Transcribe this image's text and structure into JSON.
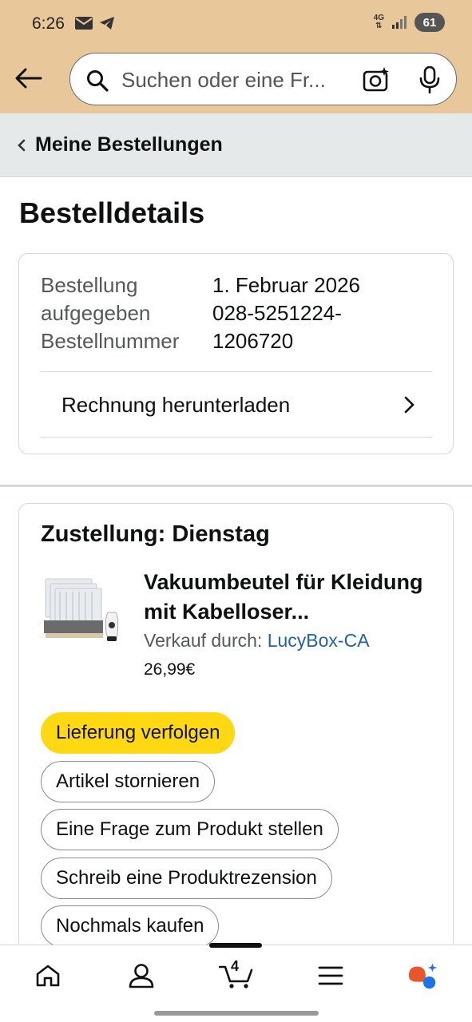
{
  "status_bar": {
    "time": "6:26",
    "network": "4G",
    "battery": "61"
  },
  "search": {
    "placeholder": "Suchen oder eine Fr..."
  },
  "breadcrumb": {
    "label": "Meine Bestellungen"
  },
  "page": {
    "title": "Bestelldetails"
  },
  "order_info": {
    "placed_label": "Bestellung aufgegeben",
    "placed_value": "1. Februar 2026",
    "number_label": "Bestellnummer",
    "number_value": "028-5251224-1206720",
    "invoice_label": "Rechnung herunterladen"
  },
  "delivery": {
    "heading": "Zustellung: Dienstag",
    "product_title": "Vakuumbeutel für Kleidung mit Kabelloser...",
    "seller_prefix": "Verkauf durch: ",
    "seller_name": "LucyBox-CA",
    "price": "26,99€",
    "buttons": {
      "track": "Lieferung verfolgen",
      "cancel": "Artikel stornieren",
      "question": "Eine Frage zum Produkt stellen",
      "review": "Schreib eine Produktrezension",
      "buy_again": "Nochmals kaufen"
    }
  },
  "bottom_nav": {
    "cart_count": "4"
  },
  "colors": {
    "header_bg": "#e8c79a",
    "primary_button": "#ffd814",
    "link": "#2162a1"
  }
}
